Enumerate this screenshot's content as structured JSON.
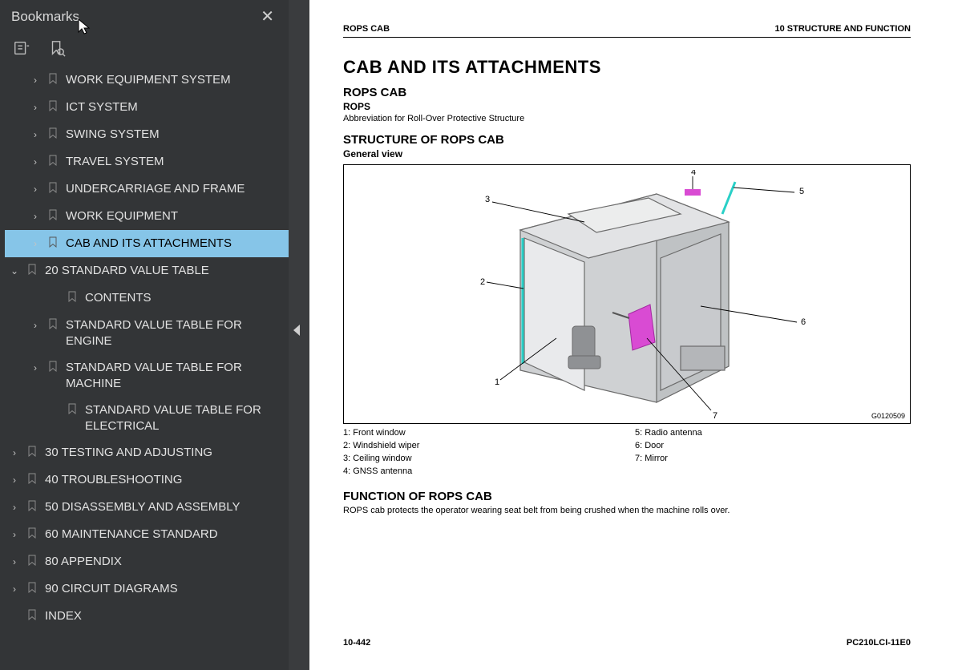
{
  "sidebar": {
    "title": "Bookmarks",
    "tree": [
      {
        "label": "WORK EQUIPMENT SYSTEM",
        "chev": ">",
        "indent": 1
      },
      {
        "label": "ICT SYSTEM",
        "chev": ">",
        "indent": 1
      },
      {
        "label": "SWING SYSTEM",
        "chev": ">",
        "indent": 1
      },
      {
        "label": "TRAVEL SYSTEM",
        "chev": ">",
        "indent": 1
      },
      {
        "label": "UNDERCARRIAGE AND FRAME",
        "chev": ">",
        "indent": 1
      },
      {
        "label": "WORK EQUIPMENT",
        "chev": ">",
        "indent": 1
      },
      {
        "label": "CAB AND ITS ATTACHMENTS",
        "chev": ">",
        "indent": 1,
        "selected": true
      },
      {
        "label": "20 STANDARD VALUE TABLE",
        "chev": "v",
        "indent": 0
      },
      {
        "label": "CONTENTS",
        "chev": "",
        "indent": 2
      },
      {
        "label": "STANDARD VALUE TABLE FOR ENGINE",
        "chev": ">",
        "indent": 1
      },
      {
        "label": "STANDARD VALUE TABLE FOR MACHINE",
        "chev": ">",
        "indent": 1
      },
      {
        "label": "STANDARD VALUE TABLE FOR ELECTRICAL",
        "chev": "",
        "indent": 2
      },
      {
        "label": "30 TESTING AND ADJUSTING",
        "chev": ">",
        "indent": 0
      },
      {
        "label": "40 TROUBLESHOOTING",
        "chev": ">",
        "indent": 0
      },
      {
        "label": "50 DISASSEMBLY AND ASSEMBLY",
        "chev": ">",
        "indent": 0
      },
      {
        "label": "60 MAINTENANCE STANDARD",
        "chev": ">",
        "indent": 0
      },
      {
        "label": "80 APPENDIX",
        "chev": ">",
        "indent": 0
      },
      {
        "label": "90 CIRCUIT DIAGRAMS",
        "chev": ">",
        "indent": 0
      },
      {
        "label": "INDEX",
        "chev": "",
        "indent": 0
      }
    ]
  },
  "doc": {
    "header_left": "ROPS CAB",
    "header_right": "10 STRUCTURE AND FUNCTION",
    "h1": "CAB AND ITS ATTACHMENTS",
    "h2a": "ROPS CAB",
    "h3a": "ROPS",
    "abbrev": "Abbreviation for Roll-Over Protective Structure",
    "h2b": "STRUCTURE OF ROPS CAB",
    "h3b": "General view",
    "fig_code": "G0120509",
    "legend_left": [
      "1: Front window",
      "2: Windshield wiper",
      "3: Ceiling window",
      "4: GNSS antenna"
    ],
    "legend_right": [
      "5: Radio antenna",
      "6: Door",
      "7: Mirror"
    ],
    "h2c": "FUNCTION OF ROPS CAB",
    "func_text": "ROPS cab protects the operator wearing seat belt from being crushed when the machine rolls over.",
    "footer_left": "10-442",
    "footer_right": "PC210LCI-11E0",
    "callouts": [
      "1",
      "2",
      "3",
      "4",
      "5",
      "6",
      "7"
    ]
  }
}
